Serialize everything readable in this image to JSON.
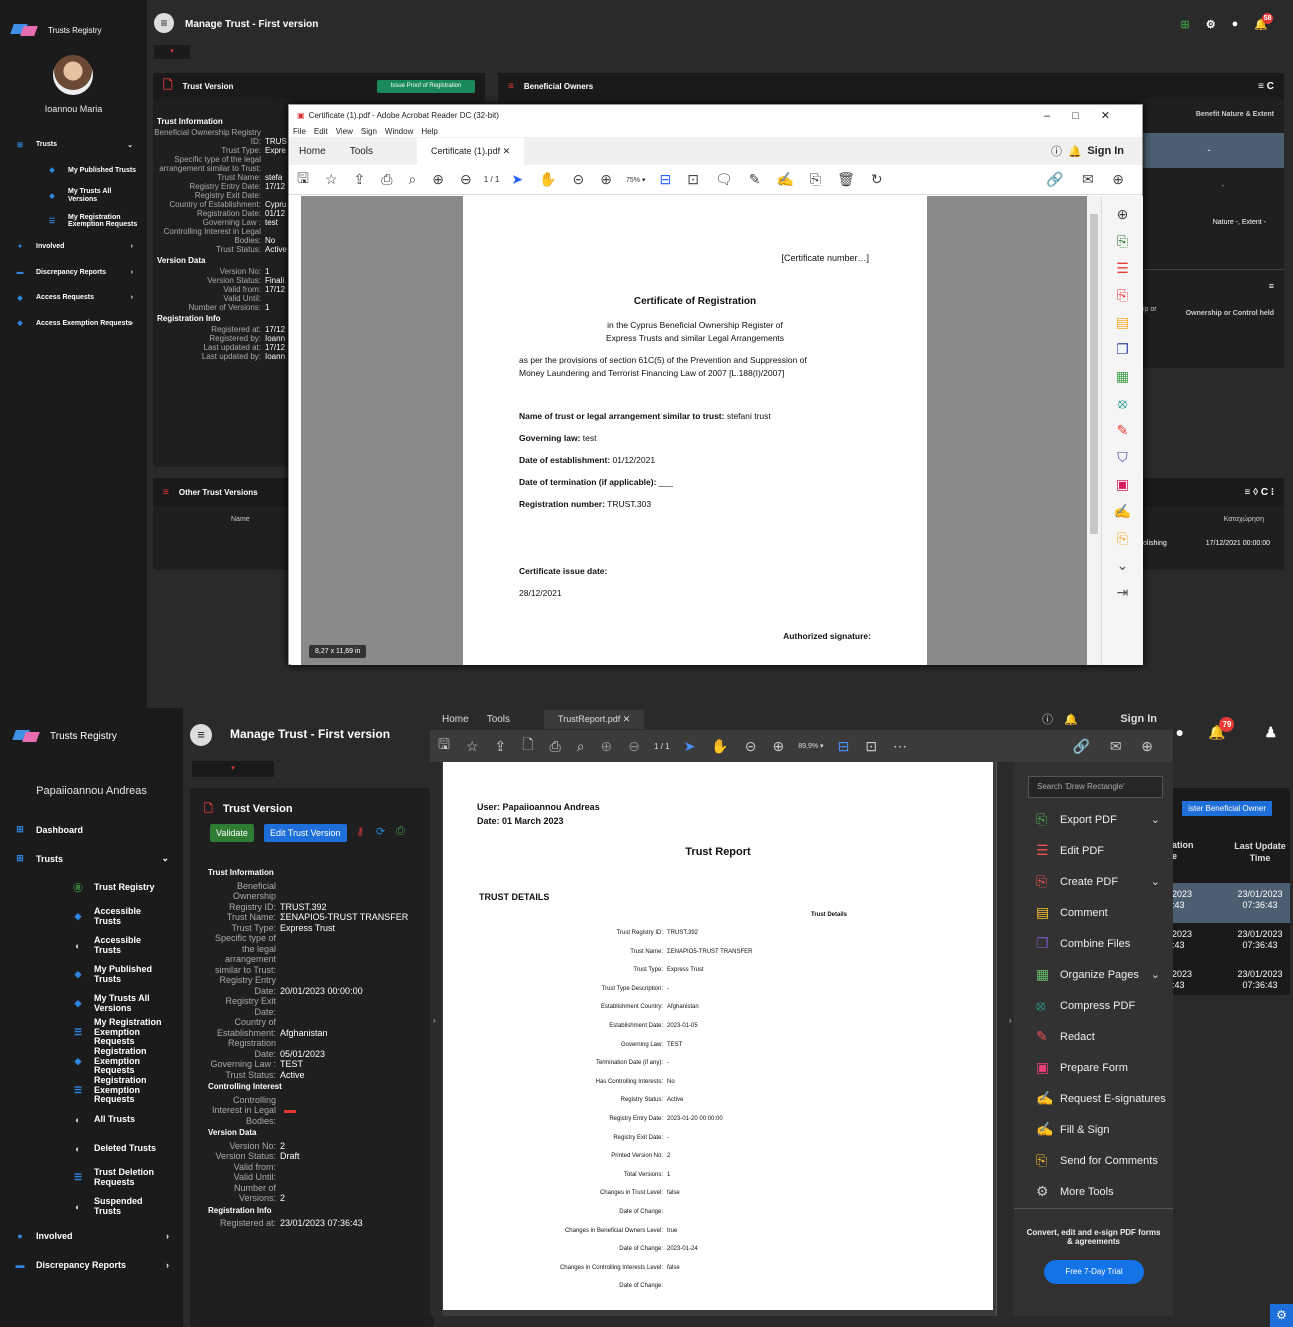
{
  "s1": {
    "brand": "Trusts Registry",
    "user": "Ioannou Maria",
    "nav": [
      {
        "label": "Trusts",
        "icon": "grid-icon",
        "chev": "⌄"
      },
      {
        "label": "My Published Trusts",
        "sub": true,
        "icon": "diamond-icon"
      },
      {
        "label": "My Trusts All Versions",
        "sub": true,
        "icon": "diamond-icon"
      },
      {
        "label": "My Registration Exemption Requests",
        "sub": true,
        "icon": "list-icon"
      },
      {
        "label": "Involved",
        "icon": "person-icon",
        "chev": "›"
      },
      {
        "label": "Discrepancy Reports",
        "icon": "folder-icon",
        "chev": "›"
      },
      {
        "label": "Access Requests",
        "icon": "diamond-icon",
        "chev": "›"
      },
      {
        "label": "Access Exemption Requests",
        "icon": "diamond-icon",
        "chev": "›"
      }
    ],
    "title": "Manage Trust - First version",
    "trust_version": "Trust Version",
    "issue_btn": "Issue Proof of Registration",
    "beneficial_owners": "Beneficial Owners",
    "benefit_nature": "Benefit Nature & Extent",
    "dash": "-",
    "nature_extent": "Nature -, Extent -",
    "ownership_control": "Ownership or Control held",
    "ip_or": "ip or",
    "katax": "Καταχώρηση",
    "olishing": "olishing",
    "date1": "17/12/2021 00:00:00",
    "other_versions": "Other Trust Versions",
    "name_col": "Name",
    "notif": "58",
    "info": {
      "trust_information": "Trust Information",
      "rows": [
        [
          "Beneficial Ownership Registry ID:",
          "TRUS"
        ],
        [
          "Trust Type:",
          "Expre"
        ],
        [
          "Specific type of the legal arrangement similar to Trust:",
          ""
        ],
        [
          "Trust Name:",
          "stefa"
        ],
        [
          "Registry Entry Date:",
          "17/12"
        ],
        [
          "Registry Exit Date:",
          ""
        ],
        [
          "Country of Establishment:",
          "Cypru"
        ],
        [
          "Registration Date:",
          "01/12"
        ],
        [
          "Governing Law :",
          "test"
        ],
        [
          "Controlling Interest in Legal Bodies:",
          "No"
        ],
        [
          "Trust Status:",
          "Active"
        ]
      ],
      "version_data": "Version Data",
      "vrows": [
        [
          "Version No:",
          "1"
        ],
        [
          "Version Status:",
          "Finali"
        ],
        [
          "Valid from:",
          "17/12"
        ],
        [
          "Valid Until:",
          ""
        ],
        [
          "Number of Versions:",
          "1"
        ]
      ],
      "registration_info": "Registration Info",
      "rrows": [
        [
          "Registered at:",
          "17/12"
        ],
        [
          "Registered by:",
          "Ioann"
        ],
        [
          "Last updated at:",
          "17/12"
        ],
        [
          "Last updated by:",
          "Ioann"
        ]
      ]
    },
    "acrobat": {
      "title": "Certificate (1).pdf - Adobe Acrobat Reader DC (32-bit)",
      "menu": [
        "File",
        "Edit",
        "View",
        "Sign",
        "Window",
        "Help"
      ],
      "tabs": [
        "Home",
        "Tools",
        "Certificate (1).pdf"
      ],
      "signin": "Sign In",
      "page": "1",
      "pages": "/ 1",
      "zoom": "75%",
      "size": "8,27 x 11,69 in",
      "cert": {
        "number": "[Certificate number…]",
        "heading": "Certificate of Registration",
        "l1": "in the Cyprus Beneficial Ownership Register of",
        "l2": "Express Trusts and similar Legal Arrangements",
        "p1": "as per the provisions of section 61C(5) of the Prevention and Suppression of",
        "p2": "Money Laundering and Terrorist Financing Law of 2007 [L.188(I)/2007]",
        "f": [
          [
            "Name of trust or legal arrangement similar to trust:",
            " stefani trust"
          ],
          [
            "Governing law:",
            " test"
          ],
          [
            "Date of establishment:",
            " 01/12/2021"
          ],
          [
            "Date of termination (if applicable):",
            " ___"
          ],
          [
            "Registration number:",
            " TRUST.303"
          ]
        ],
        "issue_label": "Certificate issue date:",
        "issue_date": "28/12/2021",
        "sig": "Authorized signature:"
      }
    }
  },
  "s2": {
    "brand": "Trusts Registry",
    "user": "Papaiioannou Andreas",
    "title": "Manage Trust - First version",
    "notif": "79",
    "nav": [
      {
        "label": "Dashboard",
        "icon": "grid-icon"
      },
      {
        "label": "Trusts",
        "icon": "grid-icon",
        "chev": "⌄"
      },
      {
        "label": "Trust Registry",
        "sub": true,
        "icon": "r-icon"
      },
      {
        "label": "Accessible Trusts",
        "sub": true,
        "icon": "diamond-icon"
      },
      {
        "label": "Accessible Trusts",
        "sub": true,
        "icon": "circle-icon"
      },
      {
        "label": "My Published Trusts",
        "sub": true,
        "icon": "diamond-icon"
      },
      {
        "label": "My Trusts All Versions",
        "sub": true,
        "icon": "diamond-icon"
      },
      {
        "label": "My Registration Exemption Requests",
        "sub": true,
        "icon": "list-icon"
      },
      {
        "label": "Registration Exemption Requests",
        "sub": true,
        "icon": "diamond-icon"
      },
      {
        "label": "Registration Exemption Requests",
        "sub": true,
        "icon": "list-icon"
      },
      {
        "label": "All Trusts",
        "sub": true,
        "icon": "circle-icon"
      },
      {
        "label": "Deleted Trusts",
        "sub": true,
        "icon": "circle-icon"
      },
      {
        "label": "Trust Deletion Requests",
        "sub": true,
        "icon": "list-icon"
      },
      {
        "label": "Suspended Trusts",
        "sub": true,
        "icon": "circle-icon"
      },
      {
        "label": "Involved",
        "icon": "person-icon",
        "chev": "›"
      },
      {
        "label": "Discrepancy Reports",
        "icon": "folder-icon",
        "chev": "›"
      }
    ],
    "trust_version": "Trust Version",
    "validate": "Validate",
    "edit": "Edit Trust Version",
    "info": {
      "trust_information": "Trust Information",
      "rows": [
        [
          "Beneficial Ownership Registry ID:",
          "TRUST.392"
        ],
        [
          "Trust Name:",
          "ΣΕΝΑΡΙΟ5-TRUST TRANSFER"
        ],
        [
          "Trust Type:",
          "Express Trust"
        ],
        [
          "Specific type of the legal arrangement similar to Trust:",
          ""
        ],
        [
          "Registry Entry Date:",
          "20/01/2023 00:00:00"
        ],
        [
          "Registry Exit Date:",
          ""
        ],
        [
          "Country of Establishment:",
          "Afghanistan"
        ],
        [
          "Registration Date:",
          "05/01/2023"
        ],
        [
          "Governing Law :",
          "TEST"
        ],
        [
          "Trust Status:",
          "Active"
        ]
      ],
      "controlling_interest": "Controlling Interest",
      "ci_label": "Controlling Interest in Legal Bodies:",
      "version_data": "Version Data",
      "vrows": [
        [
          "Version No:",
          "2"
        ],
        [
          "Version Status:",
          "Draft"
        ],
        [
          "Valid from:",
          ""
        ],
        [
          "Valid Until:",
          ""
        ],
        [
          "Number of Versions:",
          "2"
        ]
      ],
      "registration_info": "Registration Info",
      "reg_at": "Registered at:",
      "reg_at_v": "23/01/2023 07:36:43"
    },
    "right": {
      "reg_btn": "ister Beneficial Owner",
      "h1": "ation",
      "h1b": "e",
      "h2": "Last Update Time",
      "rows": [
        [
          "2023",
          ":43",
          "23/01/2023",
          "07:36:43"
        ],
        [
          "2023",
          ":43",
          "23/01/2023",
          "07:36:43"
        ],
        [
          "2023",
          ":43",
          "23/01/2023",
          "07:36:43"
        ]
      ]
    },
    "acrobat": {
      "tabs": [
        "Home",
        "Tools",
        "TrustReport.pdf"
      ],
      "signin": "Sign In",
      "page": "1",
      "pages": "/ 1",
      "zoom": "89,9%",
      "search": "Search 'Draw Rectangle'",
      "tools": [
        [
          "Export PDF",
          "export-pdf-icon",
          true
        ],
        [
          "Edit PDF",
          "edit-pdf-icon",
          false
        ],
        [
          "Create PDF",
          "create-pdf-icon",
          true
        ],
        [
          "Comment",
          "comment-icon",
          false
        ],
        [
          "Combine Files",
          "combine-icon",
          false
        ],
        [
          "Organize Pages",
          "organize-icon",
          true
        ],
        [
          "Compress PDF",
          "compress-icon",
          false
        ],
        [
          "Redact",
          "redact-icon",
          false
        ],
        [
          "Prepare Form",
          "form-icon",
          false
        ],
        [
          "Request E-signatures",
          "esign-icon",
          false
        ],
        [
          "Fill & Sign",
          "fillsign-icon",
          false
        ],
        [
          "Send for Comments",
          "send-icon",
          false
        ],
        [
          "More Tools",
          "more-tools-icon",
          false
        ]
      ],
      "promo": "Convert, edit and e-sign PDF forms & agreements",
      "trial": "Free 7-Day Trial",
      "report": {
        "user": "User: Papaiioannou Andreas",
        "date": "Date: 01 March 2023",
        "title": "Trust Report",
        "section": "TRUST DETAILS",
        "sub": "Trust Details",
        "rows": [
          [
            "Trust Registry ID:",
            "TRUST.392"
          ],
          [
            "Trust Name:",
            "ΣΕΝΑΡΙΟ5-TRUST  TRANSFER"
          ],
          [
            "Trust Type:",
            "Express Trust"
          ],
          [
            "Trust Type Description:",
            "-"
          ],
          [
            "Establishment Country:",
            "Afghanistan"
          ],
          [
            "Establishment Date:",
            "2023-01-05"
          ],
          [
            "Governing Law:",
            "TEST"
          ],
          [
            "Termination Date (if any):",
            "-"
          ],
          [
            "Has Controlling Interests:",
            "No"
          ],
          [
            "Registry Status:",
            "Active"
          ],
          [
            "Registry Entry Date:",
            "2023-01-20 00:00:00"
          ],
          [
            "Registry Exit Date:",
            "-"
          ],
          [
            "Printed Version No:",
            "2"
          ],
          [
            "Total Versions:",
            "1"
          ],
          [
            "Changes in Trust Level:",
            "false"
          ],
          [
            "Date of Change:",
            ""
          ],
          [
            "Changes in Beneficial Owners Level:",
            "true"
          ],
          [
            "Date of Change:",
            "2023-01-24"
          ],
          [
            "Changes in Controlling Interests Level:",
            "false"
          ],
          [
            "Date of Change:",
            ""
          ]
        ]
      }
    }
  }
}
